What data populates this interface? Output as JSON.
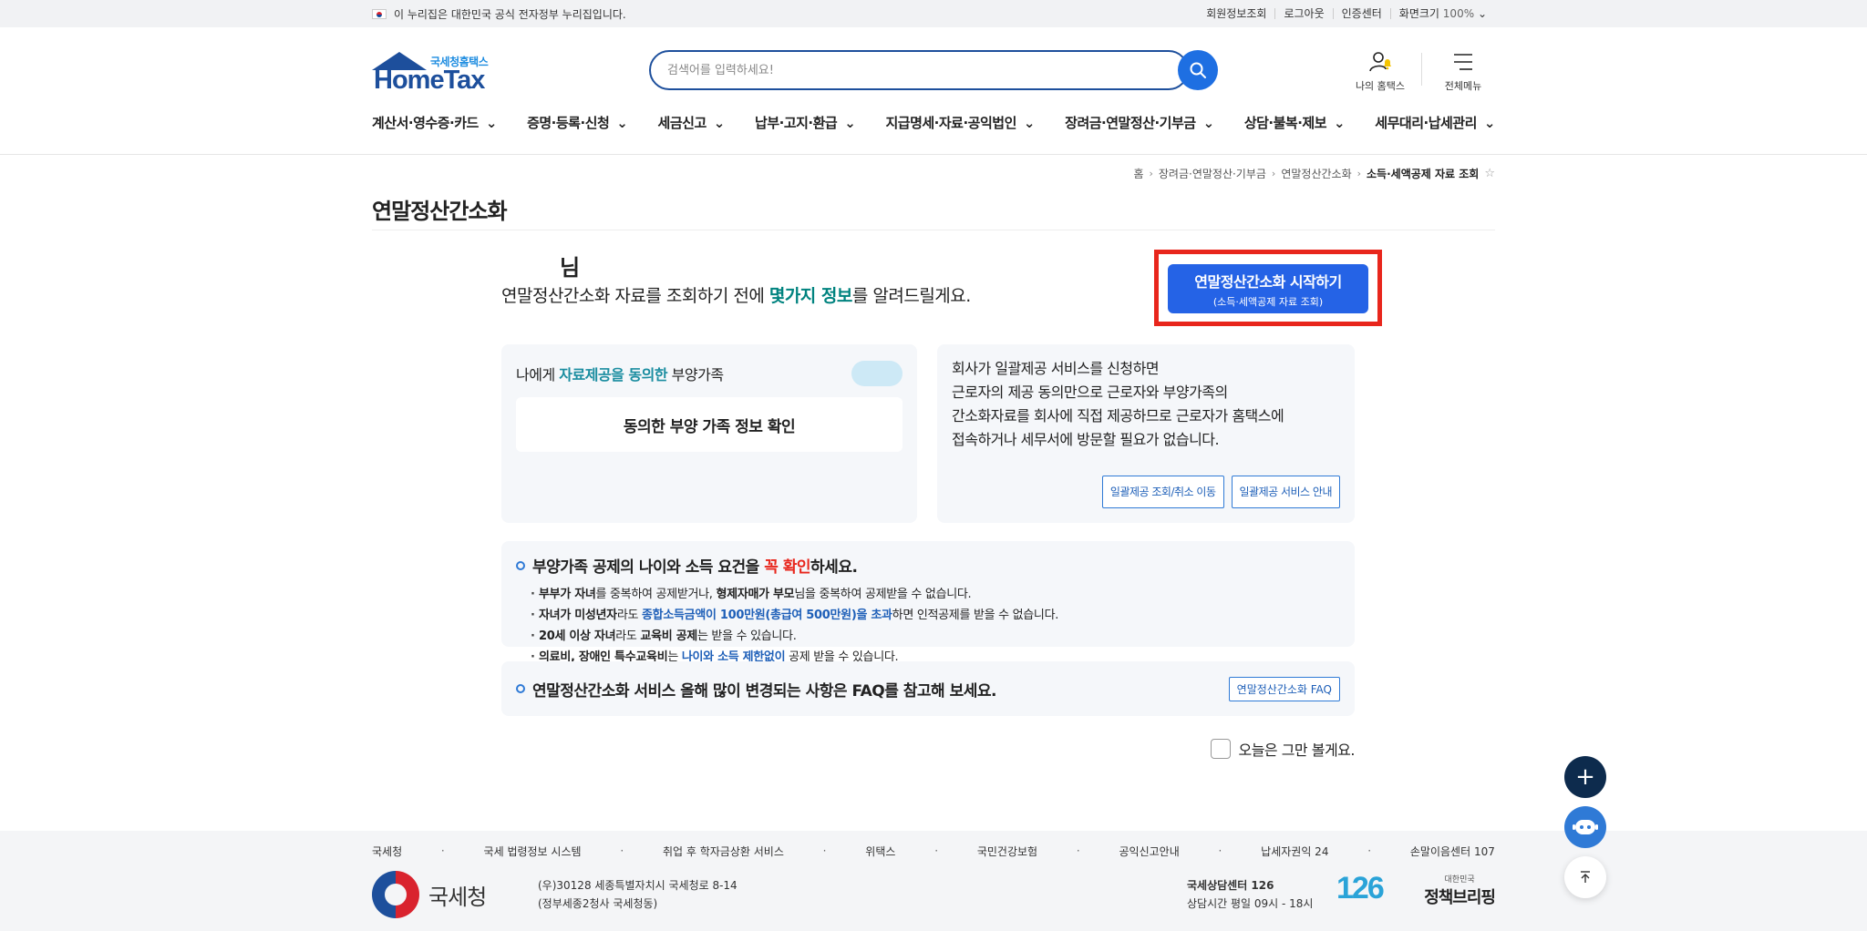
{
  "govbar": {
    "notice": "이 누리집은 대한민국 공식 전자정부 누리집입니다.",
    "links": [
      "회원정보조회",
      "로그아웃",
      "인증센터"
    ],
    "zoom_label": "화면크기",
    "zoom_value": "100%"
  },
  "header": {
    "logo_sub": "국세청홈택스",
    "logo_main": "HomeTax",
    "search_placeholder": "검색어를 입력하세요!",
    "my_hometax": "나의 홈택스",
    "all_menu": "전체메뉴"
  },
  "gnb": [
    "계산서·영수증·카드",
    "증명·등록·신청",
    "세금신고",
    "납부·고지·환급",
    "지급명세·자료·공익법인",
    "장려금·연말정산·기부금",
    "상담·불복·제보",
    "세무대리·납세관리"
  ],
  "breadcrumb": {
    "home": "홈",
    "l1": "장려금·연말정산·기부금",
    "l2": "연말정산간소화",
    "current": "소득·세액공제 자료 조회"
  },
  "page_title": "연말정산간소화",
  "greeting": {
    "suffix": "님",
    "intro_pre": "연말정산간소화 자료를 조회하기 전에 ",
    "intro_em": "몇가지 정보",
    "intro_post": "를 알려드릴게요."
  },
  "start_button": {
    "line1": "연말정산간소화 시작하기",
    "line2": "(소득·세액공제 자료 조회)"
  },
  "card_consent": {
    "pre": "나에게 ",
    "em": "자료제공을 동의한",
    "post": " 부양가족",
    "confirm": "동의한 부양 가족 정보 확인"
  },
  "card_bulk": {
    "lines": [
      "회사가 일괄제공 서비스를 신청하면",
      "근로자의 제공 동의만으로 근로자와 부양가족의",
      "간소화자료를 회사에 직접 제공하므로 근로자가 홈택스에",
      "접속하거나 세무서에 방문할 필요가 없습니다."
    ],
    "btn_view": "일괄제공 조회/취소 이동",
    "btn_info": "일괄제공 서비스 안내"
  },
  "card_dependent": {
    "title_pre": "부양가족 공제의 나이와 소득 요건을 ",
    "title_red": "꼭 확인",
    "title_post": "하세요.",
    "b1_1": "부부가 자녀",
    "b1_2": "를 중복하여 공제받거나, ",
    "b1_3": "형제자매가 부모",
    "b1_4": "님을 중복하여 공제받을 수 없습니다.",
    "b2_1": "자녀가 미성년자",
    "b2_2": "라도 ",
    "b2_3": "종합소득금액이 100만원(총급여 500만원)을 초과",
    "b2_4": "하면 인적공제를 받을 수 없습니다.",
    "b3_1": "20세 이상 자녀",
    "b3_2": "라도 ",
    "b3_3": "교육비 공제",
    "b3_4": "는 받을 수 있습니다.",
    "b4_1": "의료비, 장애인 특수교육비",
    "b4_2": "는 ",
    "b4_3": "나이와 소득 제한없이",
    "b4_4": " 공제 받을 수 있습니다."
  },
  "card_faq": {
    "title": "연말정산간소화 서비스 올해 많이 변경되는 사항은 FAQ를 참고해 보세요.",
    "button": "연말정산간소화 FAQ"
  },
  "not_today": "오늘은 그만 볼게요.",
  "footer": {
    "links": [
      "국세청",
      "국세 법령정보 시스템",
      "취업 후 학자금상환 서비스",
      "위택스",
      "국민건강보험",
      "공익신고안내",
      "납세자권익 24",
      "손말이음센터 107"
    ],
    "org_name": "국세청",
    "address1": "(우)30128 세종특별자치시 국세청로 8-14",
    "address2": "(정부세종2청사 국세청동)",
    "call_center": "국세상담센터 126",
    "call_hours": "상담시간 평일 09시 - 18시",
    "number": "126",
    "brief_small": "대한민국",
    "brief_main": "정책브리핑"
  }
}
